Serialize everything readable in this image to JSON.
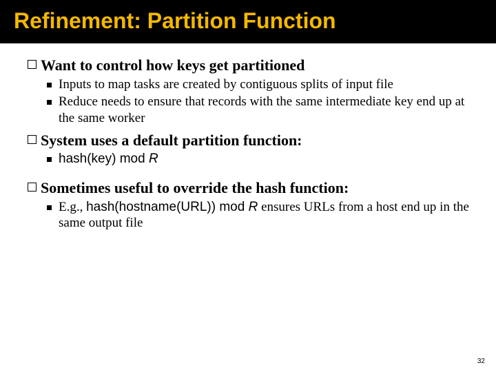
{
  "title": "Refinement: Partition Function",
  "items": [
    {
      "level": 1,
      "text": "Want to control how keys get partitioned"
    },
    {
      "level": 2,
      "text": "Inputs to map tasks are created by contiguous splits of input file"
    },
    {
      "level": 2,
      "text": "Reduce needs to ensure that records with the same intermediate key end up at the same worker"
    },
    {
      "level": 1,
      "text": "System uses a default partition function:"
    },
    {
      "level": 2,
      "code_prefix": "hash(key) mod ",
      "code_italic": "R"
    },
    {
      "level": 1,
      "text": "Sometimes useful to override the hash function:",
      "spacer_before": true
    },
    {
      "level": 2,
      "mixed_prefix": "E.g., ",
      "code_mid": "hash(hostname(URL)) mod ",
      "code_italic": "R",
      "mixed_suffix": " ensures URLs from a host end up in the same output file"
    }
  ],
  "page_number": "32"
}
